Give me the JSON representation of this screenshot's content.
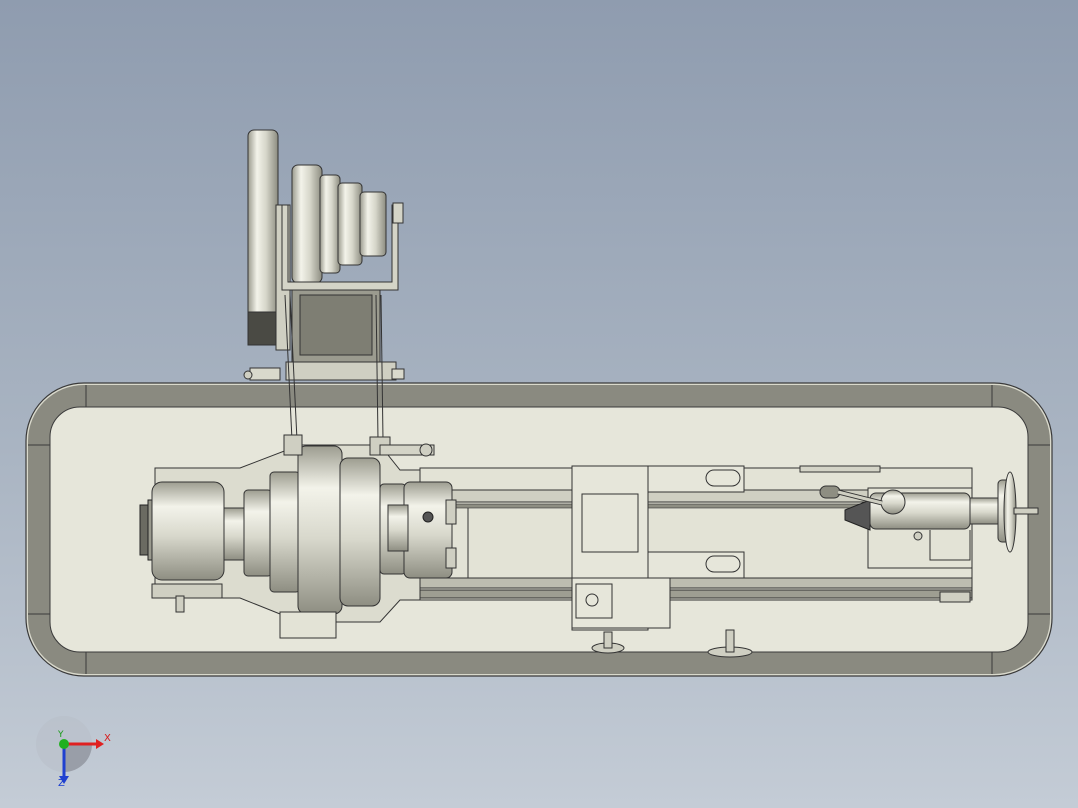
{
  "viewport": {
    "background_top": "#8f9caf",
    "background_bottom": "#c4ccd6",
    "part_fill": "#e6e6da",
    "part_shadow": "#a9a99c",
    "outline": "#3a3a3a"
  },
  "triad": {
    "x_label": "X",
    "y_label": "Y",
    "z_label": "Z",
    "x_color": "#e02020",
    "y_color": "#20b020",
    "z_color": "#2040d0"
  }
}
